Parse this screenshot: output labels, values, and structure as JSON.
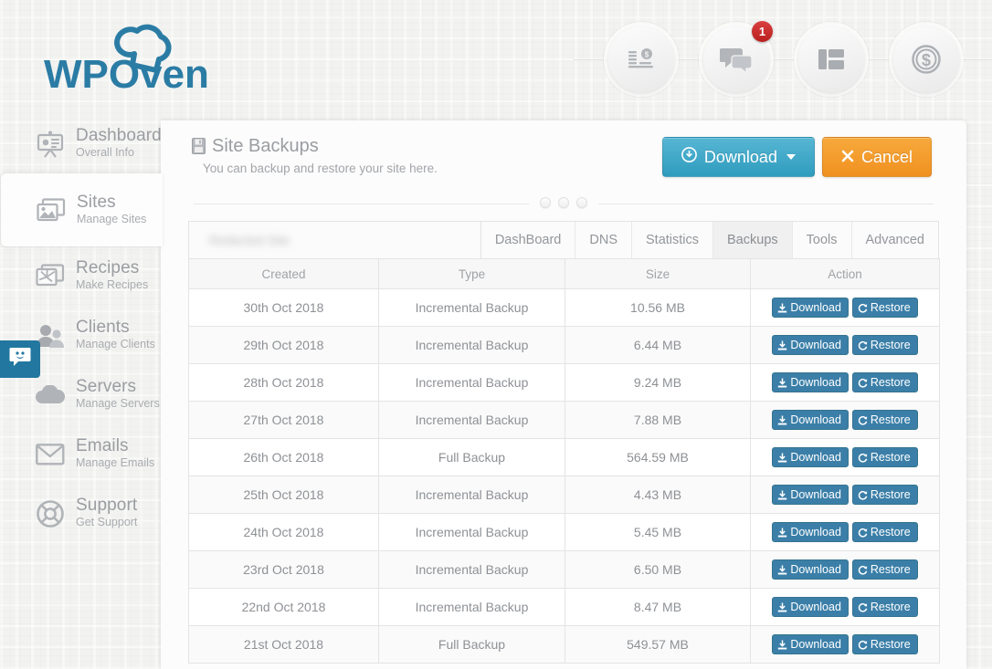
{
  "brand": {
    "name": "WPOven",
    "logo_icon": "chef-hat-icon",
    "color": "#2b7ca5"
  },
  "topbar": {
    "icons": [
      {
        "name": "billing-stack-icon",
        "label": "Billing"
      },
      {
        "name": "chat-bubbles-icon",
        "label": "Messages",
        "badge": "1"
      },
      {
        "name": "layout-panels-icon",
        "label": "Layout"
      },
      {
        "name": "dollar-coin-icon",
        "label": "Payments"
      }
    ]
  },
  "sidebar": {
    "items": [
      {
        "title": "Dashboard",
        "subtitle": "Overall Info",
        "icon": "presentation-icon",
        "active": false
      },
      {
        "title": "Sites",
        "subtitle": "Manage Sites",
        "icon": "image-icon",
        "active": true
      },
      {
        "title": "Recipes",
        "subtitle": "Make Recipes",
        "icon": "recipe-icon",
        "active": false
      },
      {
        "title": "Clients",
        "subtitle": "Manage Clients",
        "icon": "users-icon",
        "active": false
      },
      {
        "title": "Servers",
        "subtitle": "Manage Servers",
        "icon": "cloud-icon",
        "active": false
      },
      {
        "title": "Emails",
        "subtitle": "Manage Emails",
        "icon": "envelope-icon",
        "active": false
      },
      {
        "title": "Support",
        "subtitle": "Get Support",
        "icon": "lifebuoy-icon",
        "active": false
      }
    ],
    "chat_widget": {
      "icon": "smiley-chat-icon",
      "color": "#2277a0"
    }
  },
  "panel": {
    "title": "Site Backups",
    "title_icon": "hdd-save-icon",
    "subtitle": "You can backup and restore your site here.",
    "actions": {
      "download_label": "Download",
      "download_icon": "download-circle-icon",
      "download_color": "#2f9cbe",
      "cancel_label": "Cancel",
      "cancel_icon": "close-x-icon",
      "cancel_color": "#f09120"
    }
  },
  "site_tabs": {
    "site_name": "Redacted Site",
    "tabs": [
      {
        "label": "DashBoard",
        "active": false
      },
      {
        "label": "DNS",
        "active": false
      },
      {
        "label": "Statistics",
        "active": false
      },
      {
        "label": "Backups",
        "active": true
      },
      {
        "label": "Tools",
        "active": false
      },
      {
        "label": "Advanced",
        "active": false
      }
    ]
  },
  "table": {
    "columns": [
      "Created",
      "Type",
      "Size",
      "Action"
    ],
    "row_actions": {
      "download_label": "Download",
      "download_icon": "download-icon",
      "restore_label": "Restore",
      "restore_icon": "refresh-icon",
      "color": "#3b7fa8"
    },
    "rows": [
      {
        "created": "30th Oct 2018",
        "type": "Incremental Backup",
        "size": "10.56 MB"
      },
      {
        "created": "29th Oct 2018",
        "type": "Incremental Backup",
        "size": "6.44 MB"
      },
      {
        "created": "28th Oct 2018",
        "type": "Incremental Backup",
        "size": "9.24 MB"
      },
      {
        "created": "27th Oct 2018",
        "type": "Incremental Backup",
        "size": "7.88 MB"
      },
      {
        "created": "26th Oct 2018",
        "type": "Full Backup",
        "size": "564.59 MB"
      },
      {
        "created": "25th Oct 2018",
        "type": "Incremental Backup",
        "size": "4.43 MB"
      },
      {
        "created": "24th Oct 2018",
        "type": "Incremental Backup",
        "size": "5.45 MB"
      },
      {
        "created": "23rd Oct 2018",
        "type": "Incremental Backup",
        "size": "6.50 MB"
      },
      {
        "created": "22nd Oct 2018",
        "type": "Incremental Backup",
        "size": "8.47 MB"
      },
      {
        "created": "21st Oct 2018",
        "type": "Full Backup",
        "size": "549.57 MB"
      }
    ]
  }
}
